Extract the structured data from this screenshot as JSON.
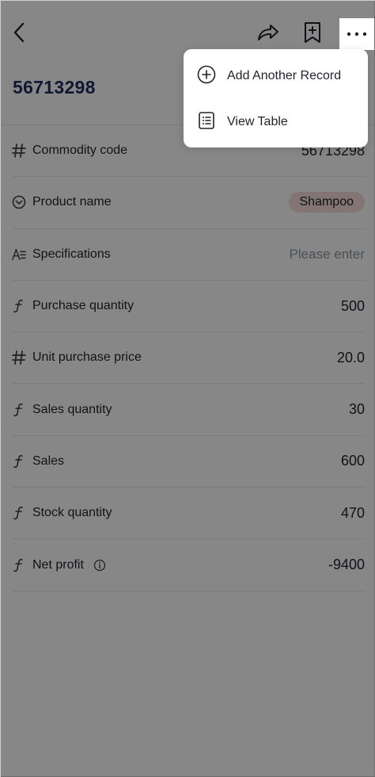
{
  "record": {
    "title": "56713298"
  },
  "fields": [
    {
      "icon": "hash-icon",
      "label": "Commodity code",
      "value": "56713298",
      "kind": "text"
    },
    {
      "icon": "single-select-icon",
      "label": "Product name",
      "value": "Shampoo",
      "kind": "tag"
    },
    {
      "icon": "text-icon",
      "label": "Specifications",
      "value": "Please enter",
      "kind": "placeholder"
    },
    {
      "icon": "formula-icon",
      "label": "Purchase quantity",
      "value": "500",
      "kind": "text"
    },
    {
      "icon": "hash-icon",
      "label": "Unit purchase price",
      "value": "20.0",
      "kind": "text"
    },
    {
      "icon": "formula-icon",
      "label": "Sales quantity",
      "value": "30",
      "kind": "text"
    },
    {
      "icon": "formula-icon",
      "label": "Sales",
      "value": "600",
      "kind": "text"
    },
    {
      "icon": "formula-icon",
      "label": "Stock quantity",
      "value": "470",
      "kind": "text"
    },
    {
      "icon": "formula-icon",
      "label": "Net profit",
      "value": "-9400",
      "kind": "text",
      "info": true
    }
  ],
  "menu": {
    "items": [
      {
        "icon": "plus-circle-icon",
        "label": "Add Another Record"
      },
      {
        "icon": "table-list-icon",
        "label": "View Table"
      }
    ]
  },
  "colors": {
    "title": "#1f2d5c",
    "tag_bg": "#f8ddd9",
    "overlay": "rgba(0,0,0,0.47)"
  }
}
